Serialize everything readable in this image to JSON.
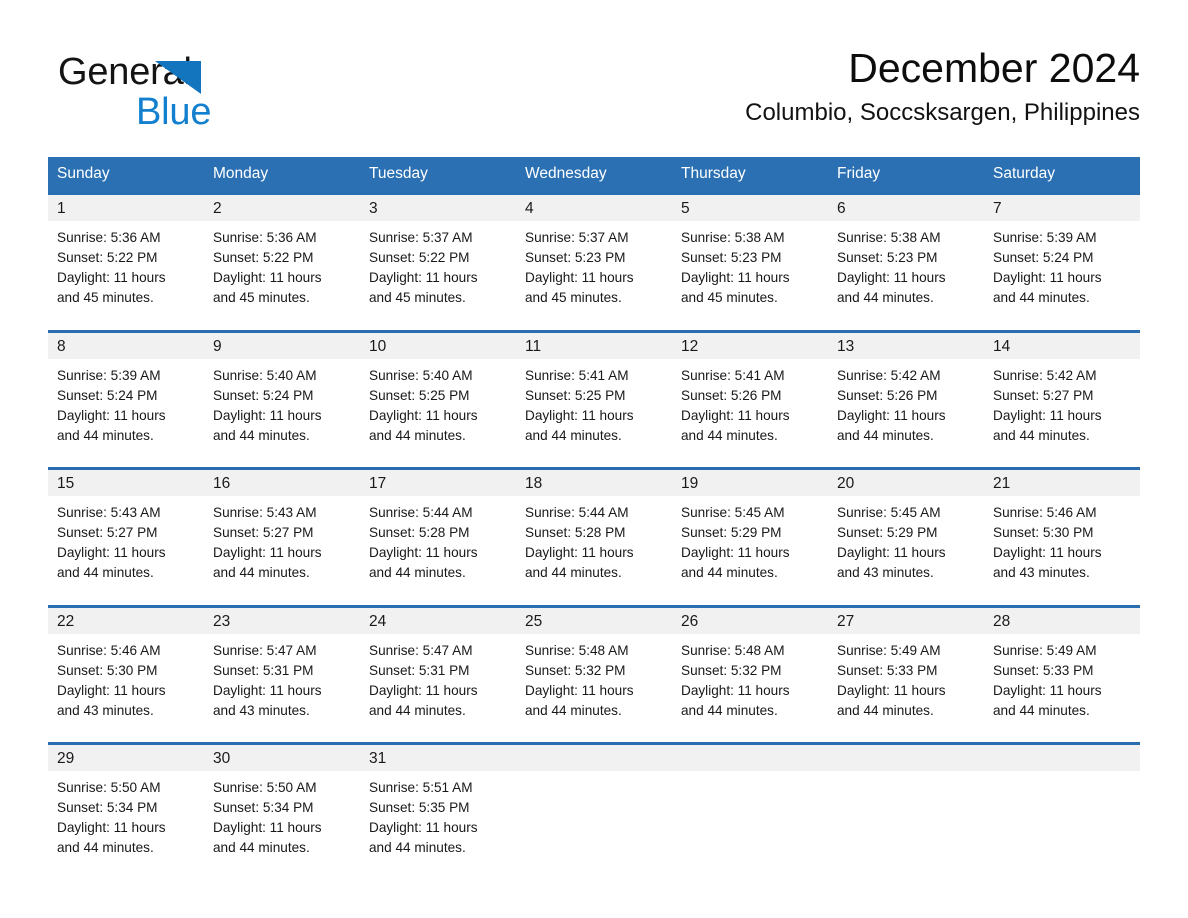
{
  "brand": {
    "name_part1": "General",
    "name_part2": "Blue",
    "triangle_color": "#1475bf",
    "logo_icon": "right-triangle-icon"
  },
  "header": {
    "title": "December 2024",
    "subtitle": "Columbio, Soccsksargen, Philippines"
  },
  "theme": {
    "header_blue": "#2b70b3",
    "row_divider_blue": "#2a6db0",
    "daynum_band": "#f1f1f1",
    "brand_blue": "#1280ce"
  },
  "weekdays": [
    "Sunday",
    "Monday",
    "Tuesday",
    "Wednesday",
    "Thursday",
    "Friday",
    "Saturday"
  ],
  "weeks": [
    {
      "days": [
        {
          "num": "1",
          "sunrise": "Sunrise: 5:36 AM",
          "sunset": "Sunset: 5:22 PM",
          "daylight1": "Daylight: 11 hours",
          "daylight2": "and 45 minutes."
        },
        {
          "num": "2",
          "sunrise": "Sunrise: 5:36 AM",
          "sunset": "Sunset: 5:22 PM",
          "daylight1": "Daylight: 11 hours",
          "daylight2": "and 45 minutes."
        },
        {
          "num": "3",
          "sunrise": "Sunrise: 5:37 AM",
          "sunset": "Sunset: 5:22 PM",
          "daylight1": "Daylight: 11 hours",
          "daylight2": "and 45 minutes."
        },
        {
          "num": "4",
          "sunrise": "Sunrise: 5:37 AM",
          "sunset": "Sunset: 5:23 PM",
          "daylight1": "Daylight: 11 hours",
          "daylight2": "and 45 minutes."
        },
        {
          "num": "5",
          "sunrise": "Sunrise: 5:38 AM",
          "sunset": "Sunset: 5:23 PM",
          "daylight1": "Daylight: 11 hours",
          "daylight2": "and 45 minutes."
        },
        {
          "num": "6",
          "sunrise": "Sunrise: 5:38 AM",
          "sunset": "Sunset: 5:23 PM",
          "daylight1": "Daylight: 11 hours",
          "daylight2": "and 44 minutes."
        },
        {
          "num": "7",
          "sunrise": "Sunrise: 5:39 AM",
          "sunset": "Sunset: 5:24 PM",
          "daylight1": "Daylight: 11 hours",
          "daylight2": "and 44 minutes."
        }
      ]
    },
    {
      "days": [
        {
          "num": "8",
          "sunrise": "Sunrise: 5:39 AM",
          "sunset": "Sunset: 5:24 PM",
          "daylight1": "Daylight: 11 hours",
          "daylight2": "and 44 minutes."
        },
        {
          "num": "9",
          "sunrise": "Sunrise: 5:40 AM",
          "sunset": "Sunset: 5:24 PM",
          "daylight1": "Daylight: 11 hours",
          "daylight2": "and 44 minutes."
        },
        {
          "num": "10",
          "sunrise": "Sunrise: 5:40 AM",
          "sunset": "Sunset: 5:25 PM",
          "daylight1": "Daylight: 11 hours",
          "daylight2": "and 44 minutes."
        },
        {
          "num": "11",
          "sunrise": "Sunrise: 5:41 AM",
          "sunset": "Sunset: 5:25 PM",
          "daylight1": "Daylight: 11 hours",
          "daylight2": "and 44 minutes."
        },
        {
          "num": "12",
          "sunrise": "Sunrise: 5:41 AM",
          "sunset": "Sunset: 5:26 PM",
          "daylight1": "Daylight: 11 hours",
          "daylight2": "and 44 minutes."
        },
        {
          "num": "13",
          "sunrise": "Sunrise: 5:42 AM",
          "sunset": "Sunset: 5:26 PM",
          "daylight1": "Daylight: 11 hours",
          "daylight2": "and 44 minutes."
        },
        {
          "num": "14",
          "sunrise": "Sunrise: 5:42 AM",
          "sunset": "Sunset: 5:27 PM",
          "daylight1": "Daylight: 11 hours",
          "daylight2": "and 44 minutes."
        }
      ]
    },
    {
      "days": [
        {
          "num": "15",
          "sunrise": "Sunrise: 5:43 AM",
          "sunset": "Sunset: 5:27 PM",
          "daylight1": "Daylight: 11 hours",
          "daylight2": "and 44 minutes."
        },
        {
          "num": "16",
          "sunrise": "Sunrise: 5:43 AM",
          "sunset": "Sunset: 5:27 PM",
          "daylight1": "Daylight: 11 hours",
          "daylight2": "and 44 minutes."
        },
        {
          "num": "17",
          "sunrise": "Sunrise: 5:44 AM",
          "sunset": "Sunset: 5:28 PM",
          "daylight1": "Daylight: 11 hours",
          "daylight2": "and 44 minutes."
        },
        {
          "num": "18",
          "sunrise": "Sunrise: 5:44 AM",
          "sunset": "Sunset: 5:28 PM",
          "daylight1": "Daylight: 11 hours",
          "daylight2": "and 44 minutes."
        },
        {
          "num": "19",
          "sunrise": "Sunrise: 5:45 AM",
          "sunset": "Sunset: 5:29 PM",
          "daylight1": "Daylight: 11 hours",
          "daylight2": "and 44 minutes."
        },
        {
          "num": "20",
          "sunrise": "Sunrise: 5:45 AM",
          "sunset": "Sunset: 5:29 PM",
          "daylight1": "Daylight: 11 hours",
          "daylight2": "and 43 minutes."
        },
        {
          "num": "21",
          "sunrise": "Sunrise: 5:46 AM",
          "sunset": "Sunset: 5:30 PM",
          "daylight1": "Daylight: 11 hours",
          "daylight2": "and 43 minutes."
        }
      ]
    },
    {
      "days": [
        {
          "num": "22",
          "sunrise": "Sunrise: 5:46 AM",
          "sunset": "Sunset: 5:30 PM",
          "daylight1": "Daylight: 11 hours",
          "daylight2": "and 43 minutes."
        },
        {
          "num": "23",
          "sunrise": "Sunrise: 5:47 AM",
          "sunset": "Sunset: 5:31 PM",
          "daylight1": "Daylight: 11 hours",
          "daylight2": "and 43 minutes."
        },
        {
          "num": "24",
          "sunrise": "Sunrise: 5:47 AM",
          "sunset": "Sunset: 5:31 PM",
          "daylight1": "Daylight: 11 hours",
          "daylight2": "and 44 minutes."
        },
        {
          "num": "25",
          "sunrise": "Sunrise: 5:48 AM",
          "sunset": "Sunset: 5:32 PM",
          "daylight1": "Daylight: 11 hours",
          "daylight2": "and 44 minutes."
        },
        {
          "num": "26",
          "sunrise": "Sunrise: 5:48 AM",
          "sunset": "Sunset: 5:32 PM",
          "daylight1": "Daylight: 11 hours",
          "daylight2": "and 44 minutes."
        },
        {
          "num": "27",
          "sunrise": "Sunrise: 5:49 AM",
          "sunset": "Sunset: 5:33 PM",
          "daylight1": "Daylight: 11 hours",
          "daylight2": "and 44 minutes."
        },
        {
          "num": "28",
          "sunrise": "Sunrise: 5:49 AM",
          "sunset": "Sunset: 5:33 PM",
          "daylight1": "Daylight: 11 hours",
          "daylight2": "and 44 minutes."
        }
      ]
    },
    {
      "days": [
        {
          "num": "29",
          "sunrise": "Sunrise: 5:50 AM",
          "sunset": "Sunset: 5:34 PM",
          "daylight1": "Daylight: 11 hours",
          "daylight2": "and 44 minutes."
        },
        {
          "num": "30",
          "sunrise": "Sunrise: 5:50 AM",
          "sunset": "Sunset: 5:34 PM",
          "daylight1": "Daylight: 11 hours",
          "daylight2": "and 44 minutes."
        },
        {
          "num": "31",
          "sunrise": "Sunrise: 5:51 AM",
          "sunset": "Sunset: 5:35 PM",
          "daylight1": "Daylight: 11 hours",
          "daylight2": "and 44 minutes."
        },
        {
          "num": "",
          "sunrise": "",
          "sunset": "",
          "daylight1": "",
          "daylight2": ""
        },
        {
          "num": "",
          "sunrise": "",
          "sunset": "",
          "daylight1": "",
          "daylight2": ""
        },
        {
          "num": "",
          "sunrise": "",
          "sunset": "",
          "daylight1": "",
          "daylight2": ""
        },
        {
          "num": "",
          "sunrise": "",
          "sunset": "",
          "daylight1": "",
          "daylight2": ""
        }
      ]
    }
  ]
}
